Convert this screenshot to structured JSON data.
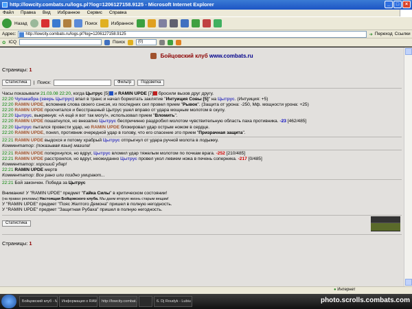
{
  "window": {
    "title": "http://lowcity.combats.ru/logs.pl?log=1206127158.9125 - Microsoft Internet Explorer"
  },
  "menu": [
    "Файл",
    "Правка",
    "Вид",
    "Избранное",
    "Сервис",
    "Справка"
  ],
  "toolbar": {
    "back": "Назад",
    "search": "Поиск",
    "favorites": "Избранное"
  },
  "address": {
    "label": "Адрес:",
    "url": "http://lowcity.combats.ru/logs.pl?log=1206127158.9125",
    "go": "Переход",
    "links": "Ссылки"
  },
  "linksbar": {
    "icq": "ICQ",
    "search": "Поиск",
    "counter": "(0)"
  },
  "page": {
    "header_title": "Бойцовский клуб",
    "header_site": "www.combats.ru",
    "pages_label": "Страницы:",
    "pages_num": "1",
    "stats_button": "Статистика",
    "sep": "|",
    "search_label": "Поиск:",
    "filter_button": "Фильтр",
    "highlight_button": "Подсветка"
  },
  "log": {
    "l0": {
      "pre": "Часы показывали ",
      "time": "21.03.08 22:20",
      "mid": ", когда ",
      "p1": "Цытрус",
      "lvl1": " [5]",
      "and": " и ",
      "p2": "RAMIN UPDE",
      "lvl2": " [7]",
      "post": " бросили вызов друг другу."
    },
    "l1": {
      "time": "22:20",
      "a": "Чупакабра (зверь Цытрус)",
      "mid": " впал в транс и начал бормотать заклятие \"",
      "spell": "Интуиция Совы [5]",
      "mid2": "\" на ",
      "target": "Цытрус",
      "post": ". (Интуиция: +5)"
    },
    "l2": {
      "time": "22:20",
      "a": "RAMIN UPDE",
      "mid": ", вспомнив слова своего сэнсэя, из последних сил провел прием \"",
      "skill": "Рывок",
      "post": "\". (Защита от урона: -250, Мф. мощности урона: +25)"
    },
    "l3": {
      "time": "22:20",
      "a": "RAMIN UPDE",
      "post": " просчитался и бесстрашный Цытрус ушел вправо от удара мощным молотом в скулу."
    },
    "l4": {
      "time": "22:20",
      "a": "Цытрус",
      "mid": ", выкрикнув: «А ещё я вот так могу!», использовал прием \"",
      "skill": "Вломить",
      "post": "\"."
    },
    "l5": {
      "time": "22:20",
      "a": "RAMIN UPDE",
      "mid": " пошатнулся, но внезапно ",
      "b": "Цытрус",
      "mid2": " беспричинно раздробил молотом чувствительную область паха противника. ",
      "dmg": "-23",
      "post": " [462/485]"
    },
    "l6": {
      "time": "22:20",
      "a": "Цытрус",
      "mid": " пытался провести удар, но ",
      "b": "RAMIN UPDE",
      "post": " блокировал удар острым ножом в сердце."
    },
    "l7": {
      "time": "22:20",
      "a": "RAMIN UPDE",
      "mid": ", понял, противник очередной удар в голову, что его спасение это прием \"",
      "skill": "Призрачная защита",
      "post": "\"."
    },
    "l8": {
      "time": "22:21",
      "a": "RAMIN UPDE",
      "mid": " выдохся и потому храбрый ",
      "b": "Цытрус",
      "post": " отпрыгнул от удара ручной молота в лодыжку."
    },
    "c1": "Комментатор: (показывая язык) мазила!",
    "l9": {
      "time": "22:21",
      "a": "RAMIN UPDE",
      "mid": " поперхнулся, но вдруг, ",
      "b": "Цытрус",
      "mid2": " вломил удар тяжелым молотом по почкам врага. ",
      "dmg": "-252",
      "post": " [210/485]"
    },
    "l10": {
      "time": "22:21",
      "a": "RAMIN UPDE",
      "mid": " расстроился, но вдруг, неожиданно ",
      "b": "Цытрус",
      "mid2": " провел укол левием ножа в печень соперника. ",
      "dmg": "-217",
      "post": " [0/485]"
    },
    "c2": "Комментатор: хороший удар!",
    "l11": {
      "time": "22:21",
      "a": "RAMIN UPDE",
      "post": " мертв"
    },
    "c3": "Комментатор: Все рано или поздно умирают...",
    "l12": {
      "time": "22:21",
      "pre": " Бой закончен. Победа за ",
      "a": "Цытрус"
    },
    "n1": {
      "pre": "Внимание! У \"RAMIN UPDE\" предмет \"",
      "item": "Гайка Силы",
      "post": "\" в критическом состоянии!"
    },
    "n2": {
      "pre": "(на правах рекламы) ",
      "b": "Настоящая Бойцовского клуба.",
      "post": " Мы даем вторую жизнь старым вещам!"
    },
    "n3": "У \"RAMIN UPDE\" предмет \"Пояс Желтого Демона\" пришел в полную негодность.",
    "n4": "У \"RAMIN UPDE\" предмет \"Защитная Рубаха\" пришел в полную негодность."
  },
  "bottom": {
    "stats_button": "Статистика",
    "pages_label": "Страницы:",
    "pages_num": "1"
  },
  "status": {
    "zone": "Интернет"
  },
  "taskbar": {
    "tasks": [
      "Бойцовский клуб - Mi...",
      "Информация о RAMIN...",
      "http://lowcity.combat...",
      "",
      "6. Dj Roudyk - Lubiu A..."
    ]
  },
  "watermark": "photo.scrolls.combats.com"
}
